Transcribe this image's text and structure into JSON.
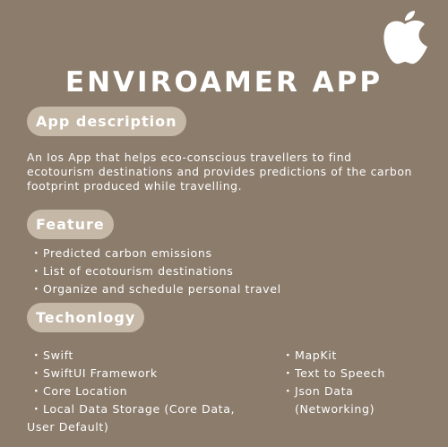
{
  "title": "ENVIROAMER APP",
  "logo_icon": "apple-logo-icon",
  "description": {
    "heading": "App description",
    "text": "An Ios App that helps eco-conscious travellers to find ecotourism destinations and provides predictions of the carbon footprint produced while travelling."
  },
  "feature": {
    "heading": "Feature",
    "items": [
      "Predicted carbon emissions",
      "List of ecotourism destinations",
      "Organize and schedule personal travel"
    ]
  },
  "technology": {
    "heading": "Techonlogy",
    "left": [
      "Swift",
      "SwiftUI Framework",
      "Core Location",
      "Local Data Storage (Core Data,"
    ],
    "left_continuation": "User Default)",
    "right": [
      "MapKit",
      "Text to Speech",
      "Json Data"
    ],
    "right_continuation": "(Networking)"
  },
  "bullet": "・",
  "colors": {
    "background": "#8b7c6c",
    "pill": "#c6b8a7",
    "text": "#ffffff"
  }
}
